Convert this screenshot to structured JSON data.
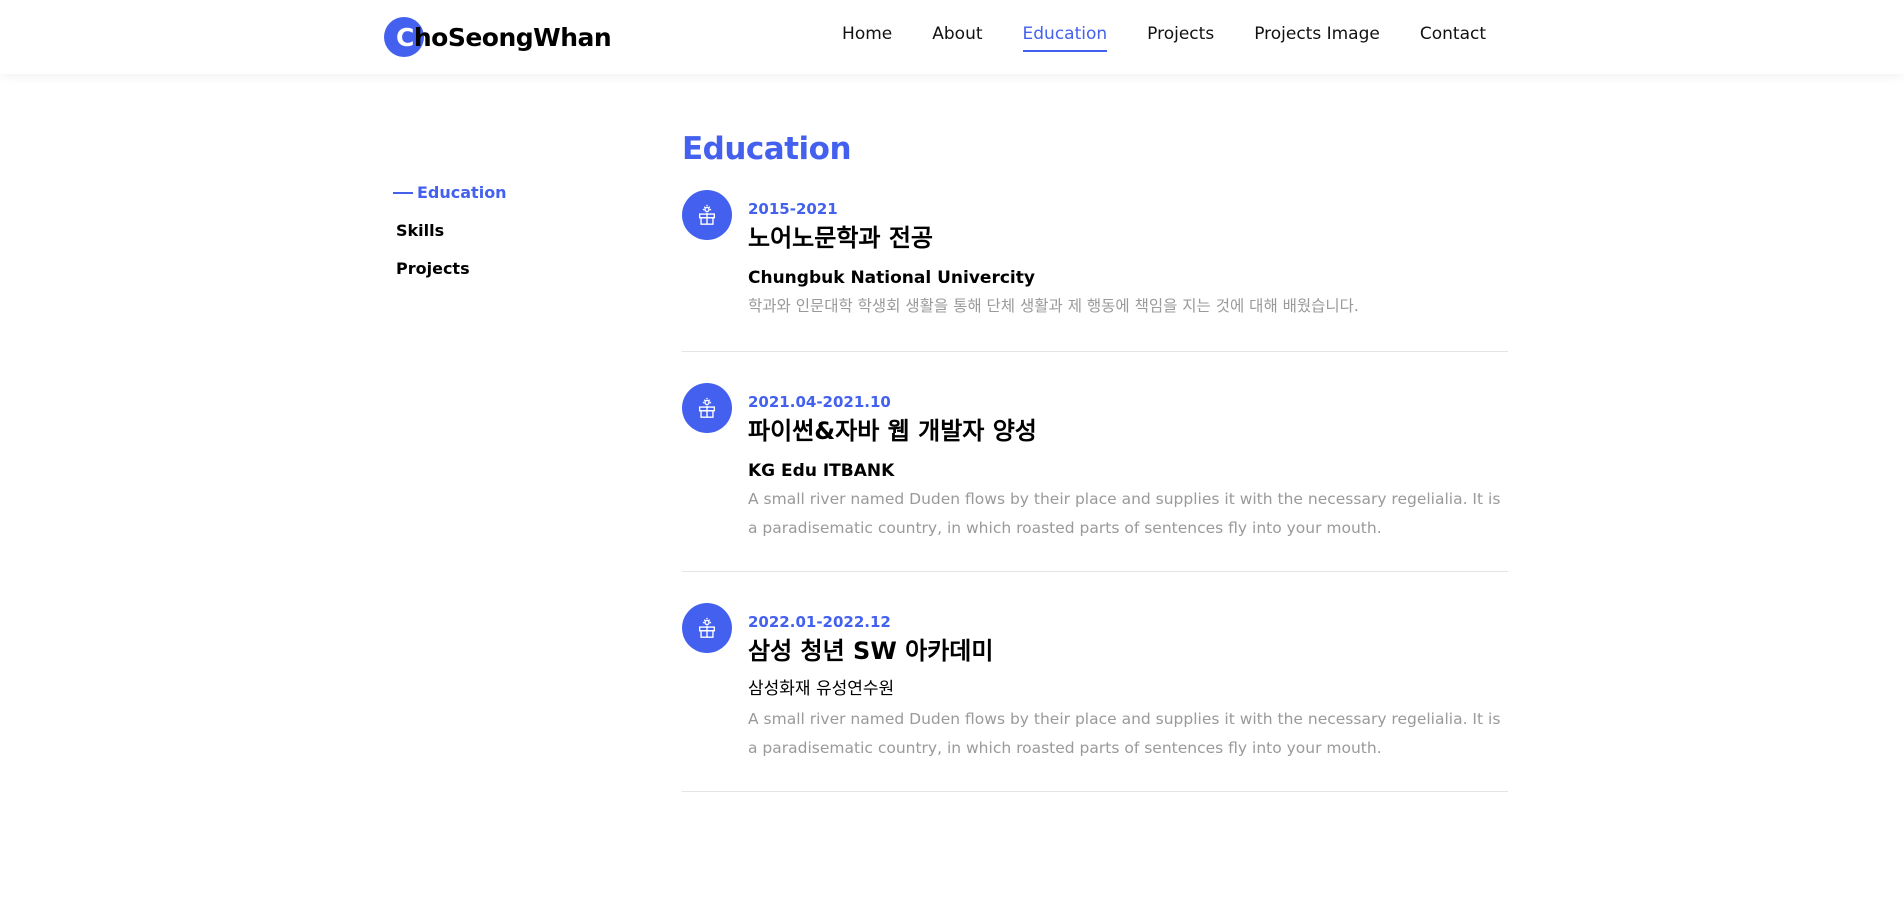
{
  "nav": {
    "brand": {
      "first_letter": "C",
      "rest": "hoSeongWhan"
    },
    "links": [
      {
        "label": "Home",
        "active": false
      },
      {
        "label": "About",
        "active": false
      },
      {
        "label": "Education",
        "active": true
      },
      {
        "label": "Projects",
        "active": false
      },
      {
        "label": "Projects Image",
        "active": false
      },
      {
        "label": "Contact",
        "active": false
      }
    ]
  },
  "sidebar": {
    "items": [
      {
        "label": "Education",
        "active": true
      },
      {
        "label": "Skills",
        "active": false
      },
      {
        "label": "Projects",
        "active": false
      }
    ]
  },
  "main": {
    "title": "Education",
    "entries": [
      {
        "icon": "education-icon",
        "date": "2015-2021",
        "title": "노어노문학과 전공",
        "org": "Chungbuk National Univercity",
        "description": "학과와 인문대학 학생회 생활을 통해 단체 생활과 제 행동에 책임을 지는 것에 대해 배웠습니다."
      },
      {
        "icon": "education-icon",
        "date": "2021.04-2021.10",
        "title": "파이썬&자바 웹 개발자 양성",
        "org": "KG Edu ITBANK",
        "description": "A small river named Duden flows by their place and supplies it with the necessary regelialia. It is a paradisematic country, in which roasted parts of sentences fly into your mouth."
      },
      {
        "icon": "education-icon",
        "date": "2022.01-2022.12",
        "title": "삼성 청년 SW 아카데미",
        "org": "삼성화재 유성연수원",
        "description": "A small river named Duden flows by their place and supplies it with the necessary regelialia. It is a paradisematic country, in which roasted parts of sentences fly into your mouth."
      }
    ]
  },
  "colors": {
    "accent": "#4361ee",
    "text": "#000000",
    "muted": "#9a9a9a",
    "divider": "#e4e4e4"
  }
}
